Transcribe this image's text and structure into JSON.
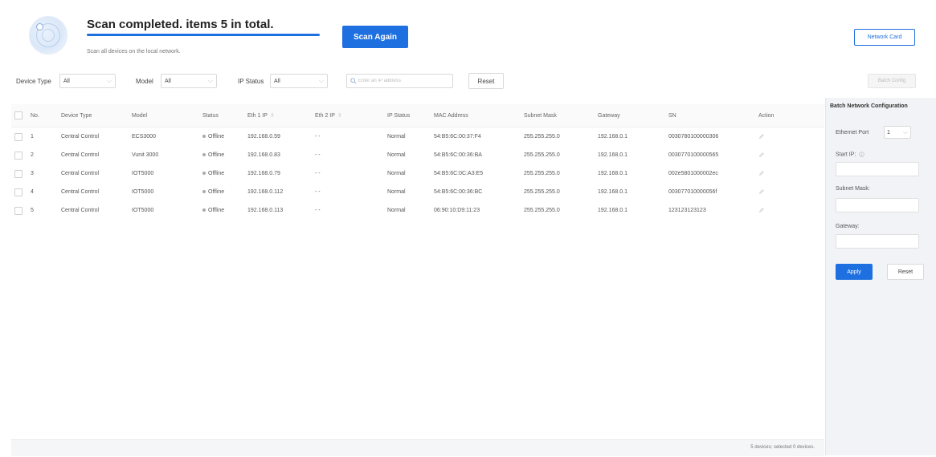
{
  "header": {
    "title": "Scan completed. items 5 in total.",
    "subtitle": "Scan all devices on the local network.",
    "scan_again_label": "Scan Again",
    "network_card_label": "Network Card",
    "accent_color": "#1e6fe0"
  },
  "filters": {
    "device_type_label": "Device Type",
    "device_type_value": "All",
    "model_label": "Model",
    "model_value": "All",
    "ip_status_label": "IP Status",
    "ip_status_value": "All",
    "search_placeholder": "Enter an IP address",
    "reset_label": "Reset",
    "batch_config_label": "Batch Config"
  },
  "table": {
    "columns": [
      "No.",
      "Device Type",
      "Model",
      "Status",
      "Eth 1 IP",
      "Eth 2 IP",
      "IP Status",
      "MAC Address",
      "Subnet Mask",
      "Gateway",
      "SN",
      "Action"
    ],
    "rows": [
      {
        "no": "1",
        "device_type": "Central Control",
        "model": "ECS3000",
        "status": "Offline",
        "eth1_ip": "192.168.0.59",
        "eth2_ip": "- -",
        "ip_status": "Normal",
        "mac": "54:B5:6C:00:37:F4",
        "subnet": "255.255.255.0",
        "gateway": "192.168.0.1",
        "sn": "0030780100000306"
      },
      {
        "no": "2",
        "device_type": "Central Control",
        "model": "Vunit 3000",
        "status": "Offline",
        "eth1_ip": "192.168.0.83",
        "eth2_ip": "- -",
        "ip_status": "Normal",
        "mac": "54:B5:6C:00:36:BA",
        "subnet": "255.255.255.0",
        "gateway": "192.168.0.1",
        "sn": "0030770100000565"
      },
      {
        "no": "3",
        "device_type": "Central Control",
        "model": "IOT5000",
        "status": "Offline",
        "eth1_ip": "192.168.0.79",
        "eth2_ip": "- -",
        "ip_status": "Normal",
        "mac": "54:B5:6C:0C:A3:E5",
        "subnet": "255.255.255.0",
        "gateway": "192.168.0.1",
        "sn": "002e5801000002ec"
      },
      {
        "no": "4",
        "device_type": "Central Control",
        "model": "IOT5000",
        "status": "Offline",
        "eth1_ip": "192.168.0.112",
        "eth2_ip": "- -",
        "ip_status": "Normal",
        "mac": "54:B5:6C:00:36:BC",
        "subnet": "255.255.255.0",
        "gateway": "192.168.0.1",
        "sn": "003077010000056f"
      },
      {
        "no": "5",
        "device_type": "Central Control",
        "model": "IOT5000",
        "status": "Offline",
        "eth1_ip": "192.168.0.113",
        "eth2_ip": "- -",
        "ip_status": "Normal",
        "mac": "06:90:10:D9:11:23",
        "subnet": "255.255.255.0",
        "gateway": "192.168.0.1",
        "sn": "123123123123"
      }
    ],
    "footer": "5 devices; selected 0 devices."
  },
  "panel": {
    "title": "Batch Network Configuration",
    "ethernet_port_label": "Ethernet Port",
    "ethernet_port_value": "1",
    "start_ip_label": "Start IP:",
    "subnet_mask_label": "Subnet Mask:",
    "gateway_label": "Gateway:",
    "apply_label": "Apply",
    "reset_label": "Reset"
  }
}
